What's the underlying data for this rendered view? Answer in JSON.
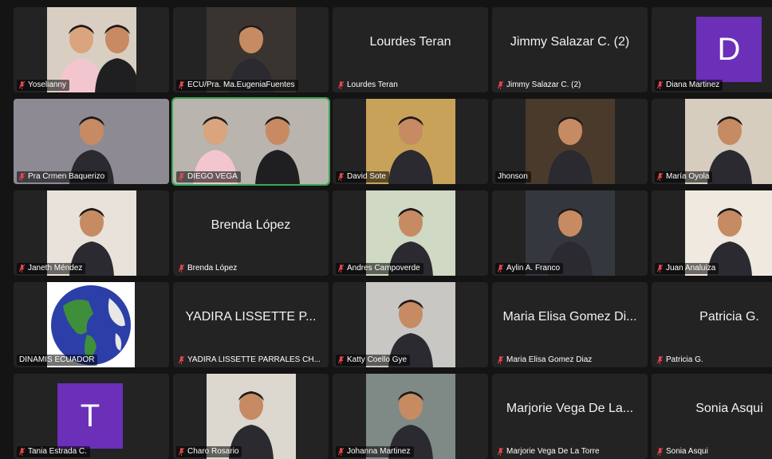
{
  "meeting": {
    "participants": [
      {
        "name": "Yoselianny",
        "display": "",
        "type": "video",
        "muted": true,
        "bg": "#d8cfc2",
        "people": 2
      },
      {
        "name": "ECU/Pra. Ma.EugeniaFuentes",
        "display": "",
        "type": "video",
        "muted": true,
        "bg": "#3a3430",
        "people": 1
      },
      {
        "name": "Lourdes Teran",
        "display": "Lourdes Teran",
        "type": "name",
        "muted": true
      },
      {
        "name": "Jimmy Salazar C. (2)",
        "display": "Jimmy Salazar C. (2)",
        "type": "name",
        "muted": true
      },
      {
        "name": "Diana Martinez",
        "display": "D",
        "type": "avatar",
        "muted": true,
        "avatarColor": "#6b2fb8"
      },
      {
        "name": "Pra Crmen  Baquerizo",
        "display": "",
        "type": "video",
        "muted": true,
        "bg": "#8e8a94",
        "people": 1
      },
      {
        "name": "DIEGO VEGA",
        "display": "",
        "type": "video",
        "muted": true,
        "bg": "#b9b4ad",
        "people": 2,
        "active": true
      },
      {
        "name": "David Sote",
        "display": "",
        "type": "video",
        "muted": true,
        "bg": "#c9a25a",
        "people": 1
      },
      {
        "name": "Jhonson",
        "display": "",
        "type": "video",
        "muted": false,
        "bg": "#4a3a2c",
        "people": 1
      },
      {
        "name": "María Oyola",
        "display": "",
        "type": "video",
        "muted": true,
        "bg": "#d6cdbf",
        "people": 1
      },
      {
        "name": "Janeth Méndez",
        "display": "",
        "type": "video",
        "muted": true,
        "bg": "#e8e2db",
        "people": 1
      },
      {
        "name": "Brenda López",
        "display": "Brenda López",
        "type": "name",
        "muted": true
      },
      {
        "name": "Andres Campoverde",
        "display": "",
        "type": "video",
        "muted": true,
        "bg": "#cfd9c4",
        "people": 1
      },
      {
        "name": "Aylin A. Franco",
        "display": "",
        "type": "video",
        "muted": true,
        "bg": "#34383e",
        "people": 1
      },
      {
        "name": "Juan Analuiza",
        "display": "",
        "type": "video",
        "muted": true,
        "bg": "#efe9df",
        "people": 1
      },
      {
        "name": "DINAMIS ECUADOR",
        "display": "",
        "type": "globe",
        "muted": false
      },
      {
        "name": "YADIRA LISSETTE PARRALES CH...",
        "display": "YADIRA LISSETTE P...",
        "type": "name",
        "muted": true
      },
      {
        "name": "Katty Coello Gye",
        "display": "",
        "type": "video",
        "muted": true,
        "bg": "#c9c7c4",
        "people": 1
      },
      {
        "name": "Maria Elisa Gomez Diaz",
        "display": "Maria Elisa Gomez Di...",
        "type": "name",
        "muted": true
      },
      {
        "name": "Patricia G.",
        "display": "Patricia G.",
        "type": "name",
        "muted": true
      },
      {
        "name": "Tania Estrada C.",
        "display": "T",
        "type": "avatar",
        "muted": true,
        "avatarColor": "#6b2fb8"
      },
      {
        "name": "Charo Rosario",
        "display": "",
        "type": "video",
        "muted": true,
        "bg": "#dcd7cf",
        "people": 1
      },
      {
        "name": "Johanna Martinez",
        "display": "",
        "type": "video",
        "muted": true,
        "bg": "#7f8a86",
        "people": 1
      },
      {
        "name": "Marjorie Vega De La Torre",
        "display": "Marjorie Vega De La...",
        "type": "name",
        "muted": true
      },
      {
        "name": "Sonia Asqui",
        "display": "Sonia Asqui",
        "type": "name",
        "muted": true
      }
    ]
  }
}
